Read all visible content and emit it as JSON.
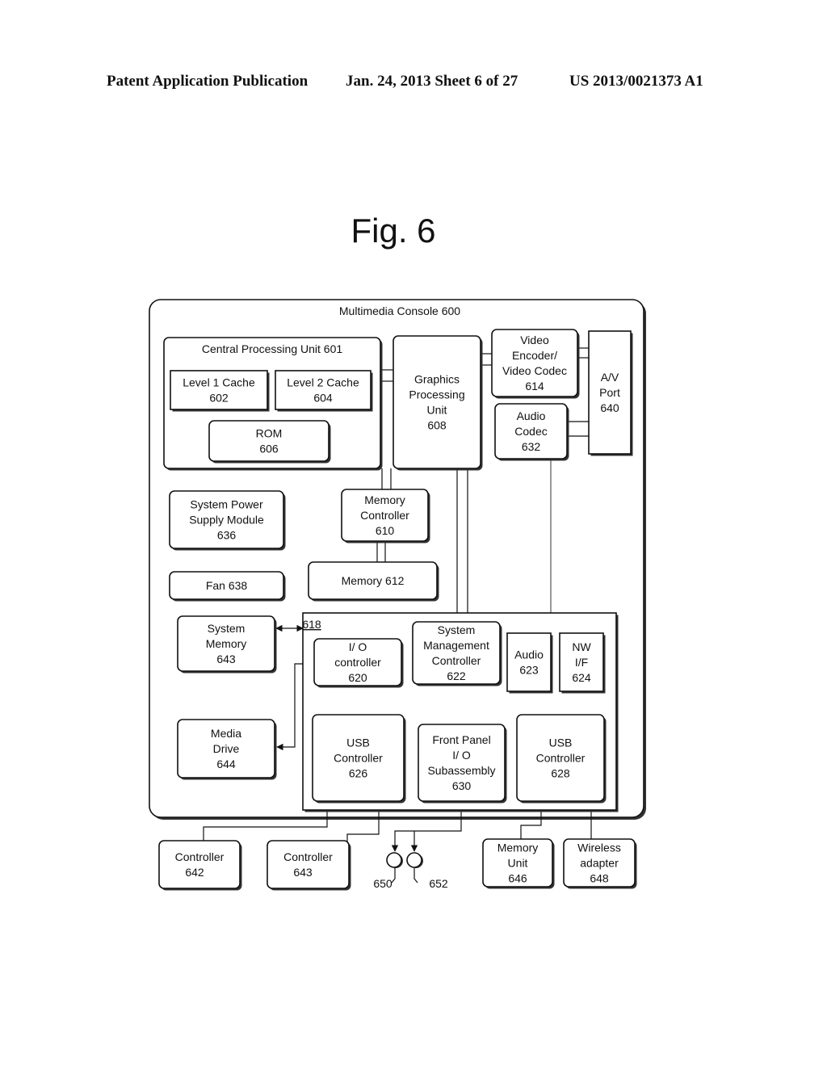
{
  "header": {
    "publication": "Patent Application Publication",
    "date_sheet": "Jan. 24, 2013   Sheet 6 of 27",
    "patent_number": "US 2013/0021373 A1"
  },
  "figure": {
    "title": "Fig. 6"
  },
  "diagram": {
    "console": {
      "label": "Multimedia Console 600"
    },
    "cpu": {
      "label": "Central Processing Unit 601"
    },
    "l1_cache": {
      "lines": [
        "Level 1 Cache",
        "602"
      ]
    },
    "l2_cache": {
      "lines": [
        "Level 2 Cache",
        "604"
      ]
    },
    "rom": {
      "lines": [
        "ROM",
        "606"
      ]
    },
    "gpu": {
      "lines": [
        "Graphics",
        "Processing",
        "Unit",
        "608"
      ]
    },
    "video_encoder": {
      "lines": [
        "Video",
        "Encoder/",
        "Video Codec",
        "614"
      ]
    },
    "av_port": {
      "lines": [
        "A/V",
        "Port",
        "640"
      ]
    },
    "audio_codec": {
      "lines": [
        "Audio",
        "Codec",
        "632"
      ]
    },
    "power_supply": {
      "lines": [
        "System Power",
        "Supply Module",
        "636"
      ]
    },
    "memory_controller": {
      "lines": [
        "Memory",
        "Controller",
        "610"
      ]
    },
    "fan": {
      "lines": [
        "Fan 638"
      ]
    },
    "memory": {
      "lines": [
        "Memory 612"
      ]
    },
    "system_memory": {
      "lines": [
        "System",
        "Memory",
        "643"
      ]
    },
    "io_block": {
      "label": "618"
    },
    "io_controller": {
      "lines": [
        "I/ O",
        "controller",
        "620"
      ]
    },
    "sys_mgmt_controller": {
      "lines": [
        "System",
        "Management",
        "Controller",
        "622"
      ]
    },
    "audio": {
      "lines": [
        "Audio",
        "623"
      ]
    },
    "nw_if": {
      "lines": [
        "NW",
        "I/F",
        "624"
      ]
    },
    "media_drive": {
      "lines": [
        "Media",
        "Drive",
        "644"
      ]
    },
    "usb_626": {
      "lines": [
        "USB",
        "Controller",
        "626"
      ]
    },
    "front_panel": {
      "lines": [
        "Front Panel",
        "I/ O",
        "Subassembly",
        "630"
      ]
    },
    "usb_628": {
      "lines": [
        "USB",
        "Controller",
        "628"
      ]
    },
    "controller_642": {
      "lines": [
        "Controller",
        "642"
      ]
    },
    "controller_643": {
      "lines": [
        "Controller",
        "643"
      ]
    },
    "port_650": {
      "label": "650"
    },
    "port_652": {
      "label": "652"
    },
    "memory_unit": {
      "lines": [
        "Memory",
        "Unit",
        "646"
      ]
    },
    "wireless_adapter": {
      "lines": [
        "Wireless",
        "adapter",
        "648"
      ]
    }
  }
}
